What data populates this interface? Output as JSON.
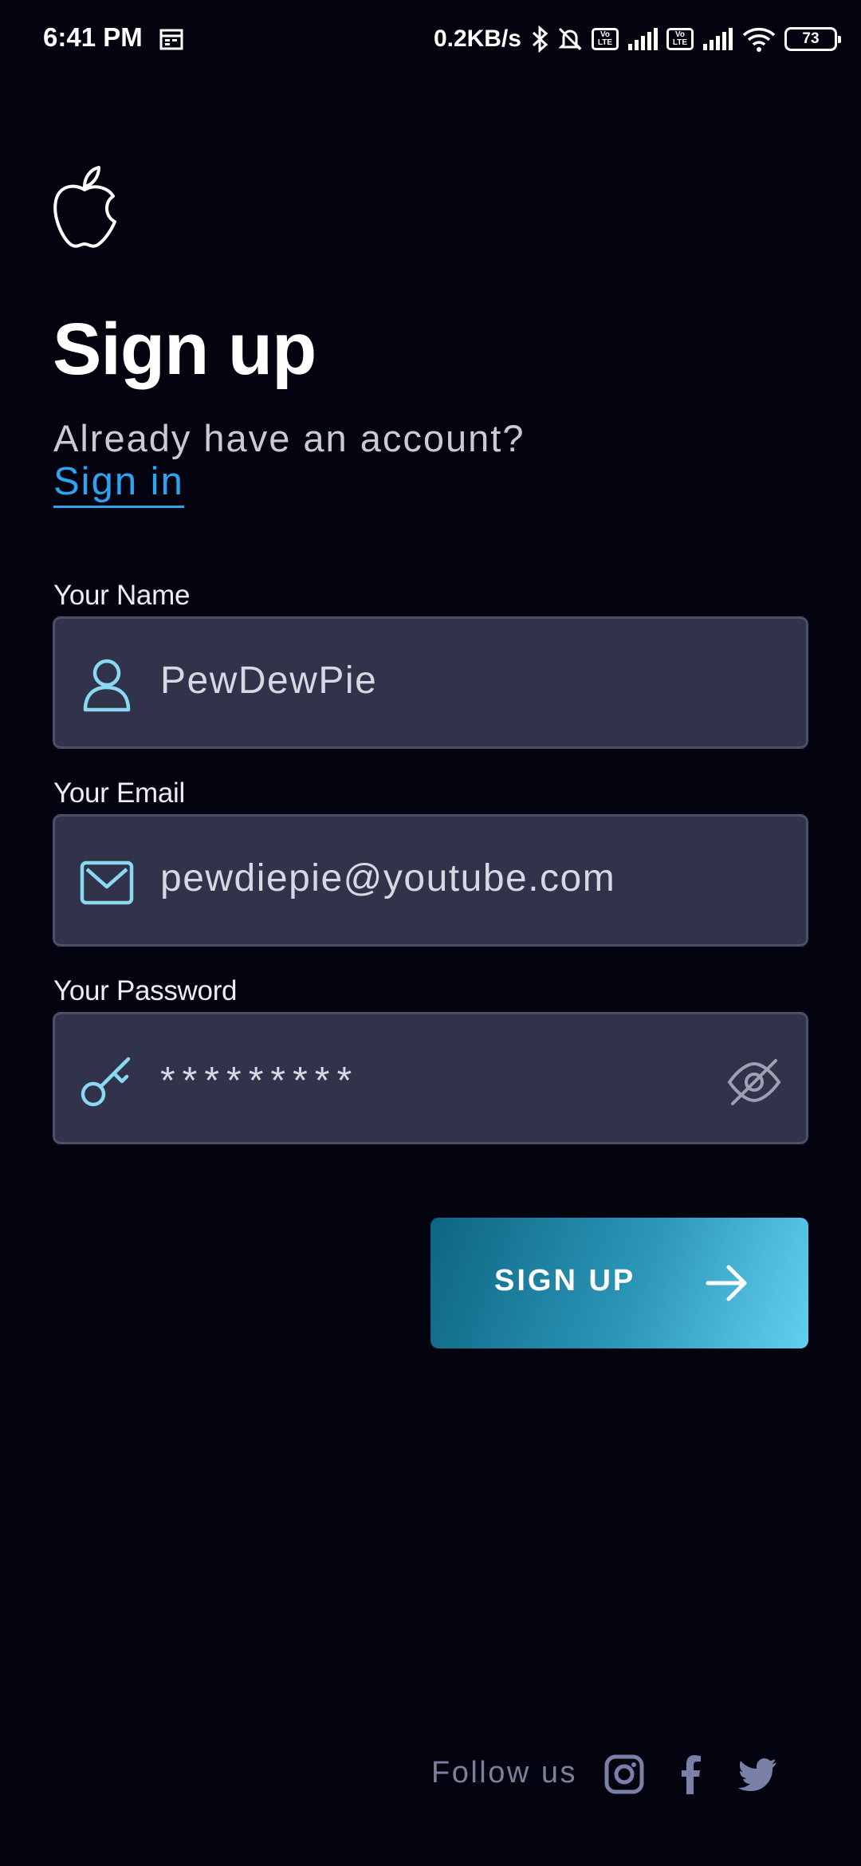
{
  "status_bar": {
    "time": "6:41 PM",
    "speed": "0.2KB/s",
    "volte_1": "Vo LTE",
    "volte_2": "Vo LTE",
    "battery": "73"
  },
  "header": {
    "logo_icon": "apple-icon",
    "title": "Sign up",
    "subtitle": "Already have an account?",
    "signin_link": "Sign in"
  },
  "form": {
    "name": {
      "label": "Your Name",
      "value": "PewDewPie",
      "icon": "user-icon"
    },
    "email": {
      "label": "Your Email",
      "value": "pewdiepie@youtube.com",
      "icon": "mail-icon"
    },
    "password": {
      "label": "Your Password",
      "value": "*********",
      "icon": "key-icon",
      "toggle_icon": "eye-off-icon"
    }
  },
  "button": {
    "label": "SIGN UP",
    "icon": "arrow-right-icon"
  },
  "footer": {
    "follow_text": "Follow us",
    "socials": [
      "instagram-icon",
      "facebook-icon",
      "twitter-icon"
    ]
  },
  "colors": {
    "background": "#03040f",
    "field_bg": "#303349",
    "link": "#2ea3f2",
    "icon_accent": "#8ad8f2",
    "button_gradient_start": "#0d6582",
    "button_gradient_end": "#62cff1"
  }
}
